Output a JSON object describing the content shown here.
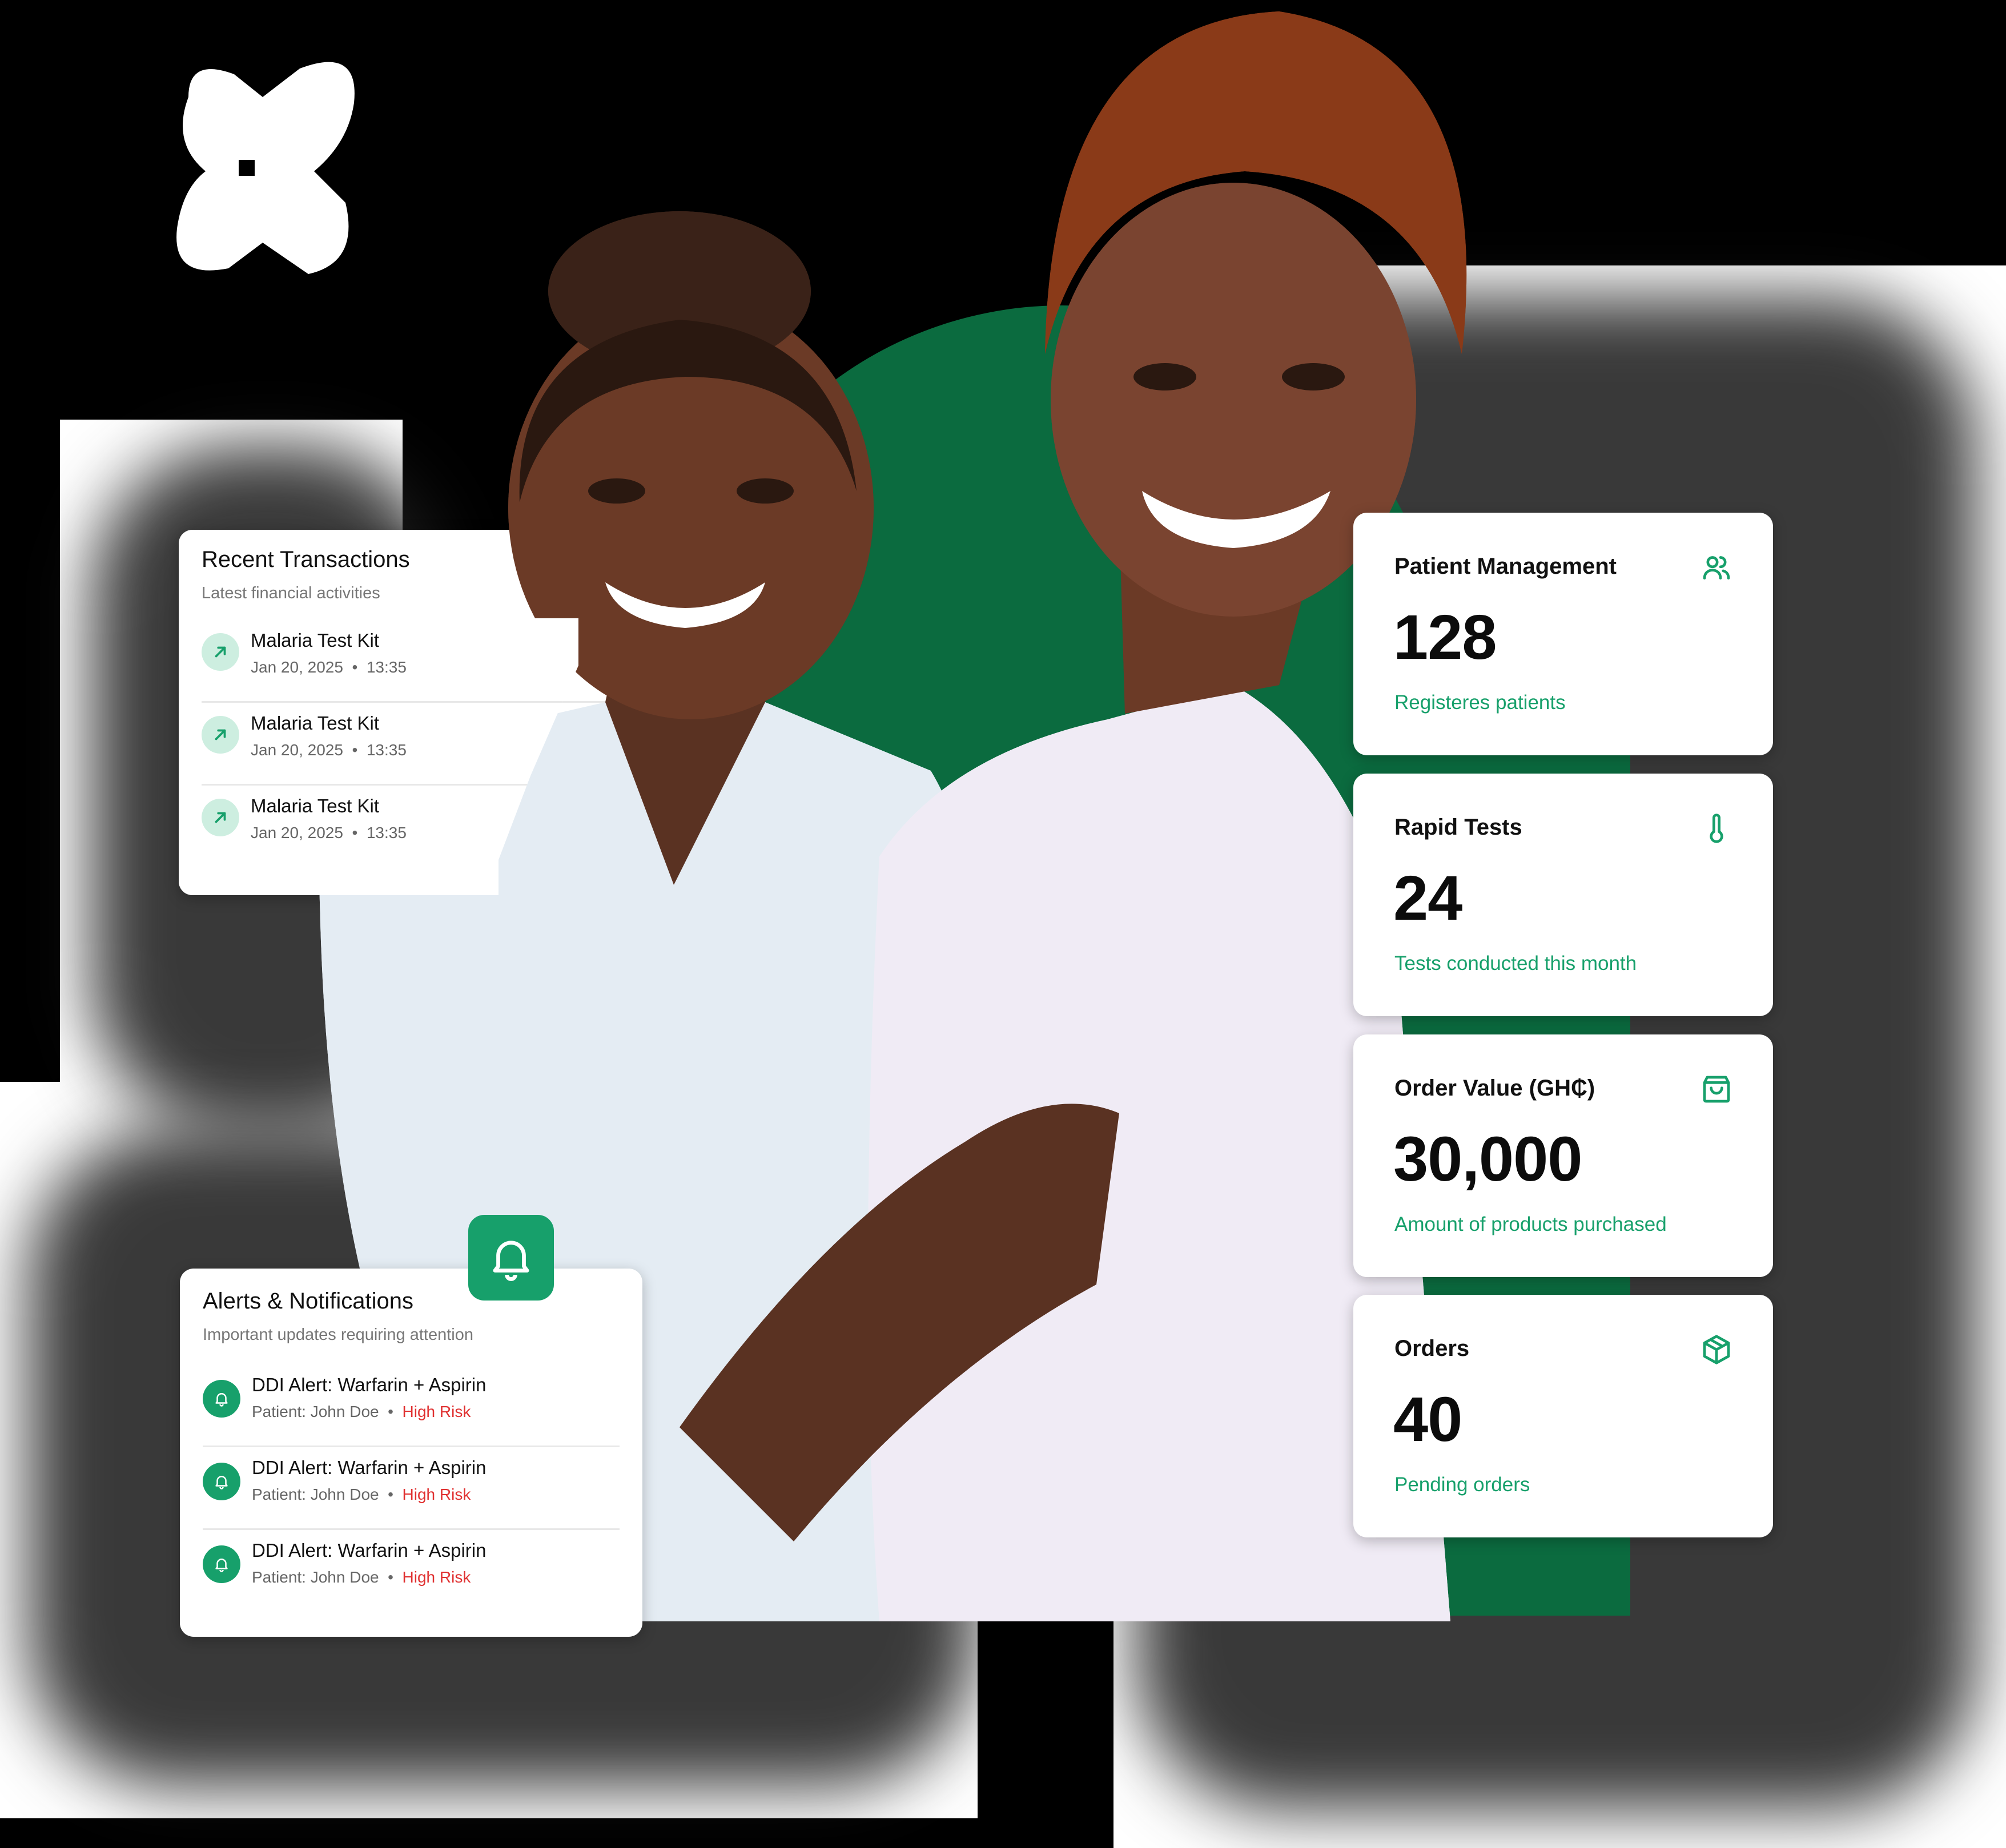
{
  "brand": {
    "accent": "#17a06b",
    "dark_green": "#0b6b3f",
    "risk": "#e03131"
  },
  "transactions": {
    "title": "Recent Transactions",
    "subtitle": "Latest financial activities",
    "items": [
      {
        "name": "Malaria Test Kit",
        "date": "Jan 20, 2025",
        "time": "13:35",
        "icon": "arrow-up-right-icon"
      },
      {
        "name": "Malaria Test Kit",
        "date": "Jan 20, 2025",
        "time": "13:35",
        "icon": "arrow-up-right-icon"
      },
      {
        "name": "Malaria Test Kit",
        "date": "Jan 20, 2025",
        "time": "13:35",
        "icon": "arrow-up-right-icon"
      }
    ]
  },
  "alerts": {
    "title": "Alerts & Notifications",
    "subtitle": "Important updates requiring attention",
    "badge_icon": "bell-icon",
    "items": [
      {
        "name": "DDI Alert: Warfarin + Aspirin",
        "patient": "Patient: John Doe",
        "risk": "High Risk"
      },
      {
        "name": "DDI Alert: Warfarin + Aspirin",
        "patient": "Patient: John Doe",
        "risk": "High Risk"
      },
      {
        "name": "DDI Alert: Warfarin + Aspirin",
        "patient": "Patient: John Doe",
        "risk": "High Risk"
      }
    ]
  },
  "stats": [
    {
      "title": "Patient Management",
      "value": "128",
      "desc": "Registeres patients",
      "icon": "users-icon"
    },
    {
      "title": "Rapid Tests",
      "value": "24",
      "desc": "Tests conducted this month",
      "icon": "thermometer-icon"
    },
    {
      "title": "Order Value (GH₵)",
      "value": "30,000",
      "desc": "Amount of products purchased",
      "icon": "shopping-bag-icon"
    },
    {
      "title": "Orders",
      "value": "40",
      "desc": "Pending orders",
      "icon": "package-icon"
    }
  ]
}
